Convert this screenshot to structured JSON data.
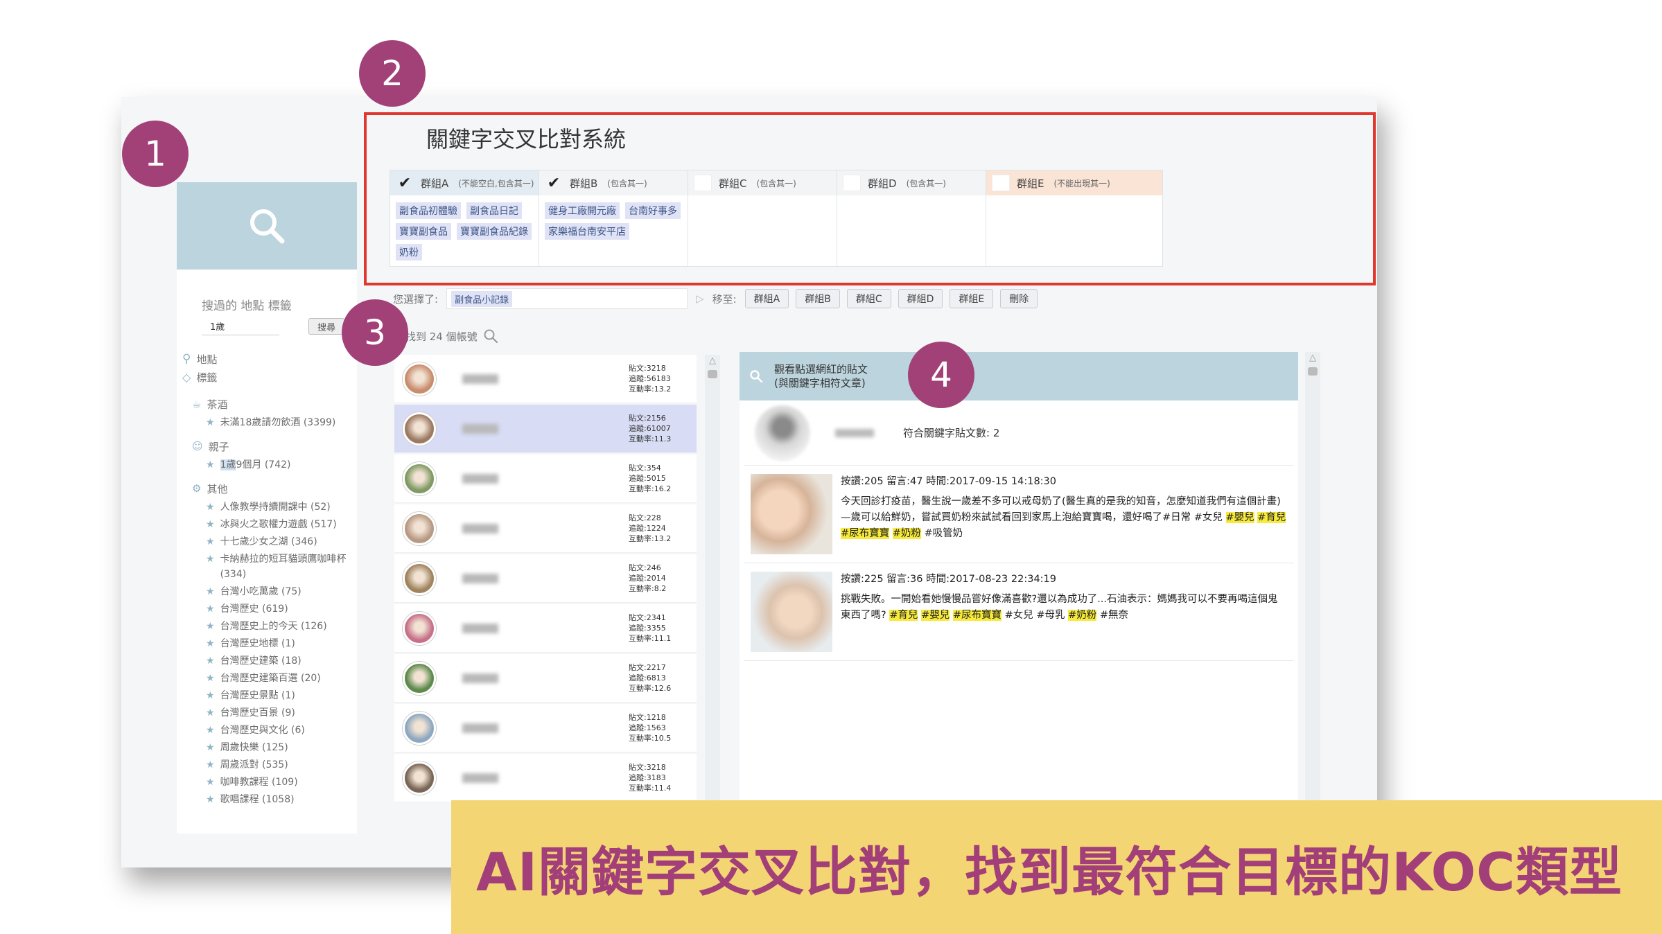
{
  "steps": [
    "1",
    "2",
    "3",
    "4"
  ],
  "system_title": "關鍵字交叉比對系統",
  "sidebar": {
    "search_history_label": "搜過的 地點 標籤",
    "search_value": "1歲",
    "search_button": "搜尋",
    "location_label": "地點",
    "tag_label": "標籤",
    "categories": [
      {
        "icon": "tea-icon",
        "name": "茶酒",
        "items": [
          {
            "prefix": "",
            "highlight": "",
            "rest": "未滿18歲請勿飲酒 (3399)"
          }
        ]
      },
      {
        "icon": "parent-child-icon",
        "name": "親子",
        "items": [
          {
            "prefix": "",
            "highlight": "1歲",
            "rest": "9個月 (742)"
          }
        ]
      },
      {
        "icon": "gear-icon",
        "name": "其他",
        "items": [
          {
            "prefix": "",
            "highlight": "",
            "rest": "人像教學持續開課中 (52)"
          },
          {
            "prefix": "",
            "highlight": "",
            "rest": "冰與火之歌權力遊戲 (517)"
          },
          {
            "prefix": "",
            "highlight": "",
            "rest": "十七歲少女之湖 (346)"
          },
          {
            "prefix": "",
            "highlight": "",
            "rest": "卡納赫拉的短耳貓頭鷹咖啡杯 (334)"
          },
          {
            "prefix": "",
            "highlight": "",
            "rest": "台灣小吃萬歲 (75)"
          },
          {
            "prefix": "",
            "highlight": "",
            "rest": "台灣歷史 (619)"
          },
          {
            "prefix": "",
            "highlight": "",
            "rest": "台灣歷史上的今天 (126)"
          },
          {
            "prefix": "",
            "highlight": "",
            "rest": "台灣歷史地標 (1)"
          },
          {
            "prefix": "",
            "highlight": "",
            "rest": "台灣歷史建築 (18)"
          },
          {
            "prefix": "",
            "highlight": "",
            "rest": "台灣歷史建築百選 (20)"
          },
          {
            "prefix": "",
            "highlight": "",
            "rest": "台灣歷史景點 (1)"
          },
          {
            "prefix": "",
            "highlight": "",
            "rest": "台灣歷史百景 (9)"
          },
          {
            "prefix": "",
            "highlight": "",
            "rest": "台灣歷史與文化 (6)"
          },
          {
            "prefix": "",
            "highlight": "",
            "rest": "周歲快樂 (125)"
          },
          {
            "prefix": "",
            "highlight": "",
            "rest": "周歲派對 (535)"
          },
          {
            "prefix": "",
            "highlight": "",
            "rest": "咖啡教課程 (109)"
          },
          {
            "prefix": "",
            "highlight": "",
            "rest": "歌唱課程 (1058)"
          }
        ]
      }
    ]
  },
  "groups": [
    {
      "name": "群組A",
      "note": "(不能空白,包含其一)",
      "checked": true,
      "tint": "#e2ecf2",
      "tags": [
        "副食品初體驗",
        "副食品日記",
        "寶寶副食品",
        "寶寶副食品紀錄",
        "奶粉"
      ]
    },
    {
      "name": "群組B",
      "note": "(包含其一)",
      "checked": true,
      "tint": "#f3f4f5",
      "tags": [
        "健身工廠開元廠",
        "台南好事多",
        "家樂福台南安平店"
      ]
    },
    {
      "name": "群組C",
      "note": "(包含其一)",
      "checked": false,
      "tint": "#f3f4f5",
      "tags": []
    },
    {
      "name": "群組D",
      "note": "(包含其一)",
      "checked": false,
      "tint": "#f3f4f5",
      "tags": []
    },
    {
      "name": "群組E",
      "note": "(不能出現其一)",
      "checked": false,
      "tint": "#f9e4d5",
      "tags": []
    }
  ],
  "selection": {
    "label": "您選擇了:",
    "selected_tag": "副食品小記錄",
    "move_label": "移至:",
    "buttons": [
      "群組A",
      "群組B",
      "群組C",
      "群組D",
      "群組E",
      "刪除"
    ]
  },
  "results": {
    "found_label": "找到 24 個帳號",
    "accounts": [
      {
        "posts": "貼文:3218",
        "tracks": "追蹤:56183",
        "rate": "互動率:13.2",
        "active": false,
        "color": "#c98d6e"
      },
      {
        "posts": "貼文:2156",
        "tracks": "追蹤:61007",
        "rate": "互動率:11.3",
        "active": true,
        "color": "#9c7a63"
      },
      {
        "posts": "貼文:354",
        "tracks": "追蹤:5015",
        "rate": "互動率:16.2",
        "active": false,
        "color": "#7f9a63"
      },
      {
        "posts": "貼文:228",
        "tracks": "追蹤:1224",
        "rate": "互動率:13.2",
        "active": false,
        "color": "#b89a84"
      },
      {
        "posts": "貼文:246",
        "tracks": "追蹤:2014",
        "rate": "互動率:8.2",
        "active": false,
        "color": "#a0845f"
      },
      {
        "posts": "貼文:2341",
        "tracks": "追蹤:3355",
        "rate": "互動率:11.1",
        "active": false,
        "color": "#c77189"
      },
      {
        "posts": "貼文:2217",
        "tracks": "追蹤:6813",
        "rate": "互動率:12.6",
        "active": false,
        "color": "#5e8a4c"
      },
      {
        "posts": "貼文:1218",
        "tracks": "追蹤:1563",
        "rate": "互動率:10.5",
        "active": false,
        "color": "#8fa8c0"
      },
      {
        "posts": "貼文:3218",
        "tracks": "追蹤:3183",
        "rate": "互動率:11.4",
        "active": false,
        "color": "#7a6656"
      }
    ]
  },
  "panel": {
    "title_line1": "觀看點選網紅的貼文",
    "title_line2": "(與關鍵字相符文章)",
    "match_count": "符合關鍵字貼文數: 2",
    "posts": [
      {
        "meta": "按讚:205 留言:47   時間:2017-09-15  14:18:30",
        "text": "今天回診打疫苗，醫生說一歲差不多可以戒母奶了(醫生真的是我的知音，怎麼知道我們有這個計畫)—歲可以給鮮奶，嘗試買奶粉來試試看回到家馬上泡給寶寶喝，還好喝了#日常 #女兒 ",
        "tags_hl": [
          "#嬰兒",
          "#育兒",
          "#尿布寶寶",
          "#奶粉"
        ],
        "tail": " #吸管奶"
      },
      {
        "meta": "按讚:225 留言:36   時間:2017-08-23  22:34:19",
        "text": "挑戰失敗。一開始看她慢慢品嘗好像滿喜歡?還以為成功了...石油表示：媽媽我可以不要再喝這個鬼東西了嗎? ",
        "tags_hl": [
          "#育兒",
          "#嬰兒",
          "#尿布寶寶"
        ],
        "tail": " #女兒 #母乳 ",
        "tags_hl2": [
          "#奶粉"
        ],
        "tail2": " #無奈"
      }
    ]
  },
  "banner_text": "AI關鍵字交叉比對，找到最符合目標的KOC類型",
  "colors": {
    "accent": "#a24177",
    "frame": "#e0382f",
    "header": "#bcd4dd",
    "banner": "#f3d574"
  }
}
